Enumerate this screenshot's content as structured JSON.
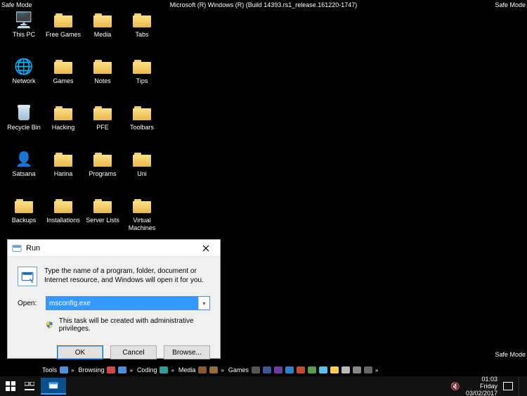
{
  "safemode": {
    "topLeft": "Safe Mode",
    "topRight": "Safe Mode",
    "bottomRight": "Safe Mode",
    "build": "Microsoft (R) Windows (R) (Build 14393.rs1_release.161220-1747)"
  },
  "desktop": [
    {
      "label": "This PC",
      "icon": "pc"
    },
    {
      "label": "Free Games",
      "icon": "folder"
    },
    {
      "label": "Media",
      "icon": "folder"
    },
    {
      "label": "Tabs",
      "icon": "folder"
    },
    null,
    {
      "label": "Network",
      "icon": "network"
    },
    {
      "label": "Games",
      "icon": "folder"
    },
    {
      "label": "Notes",
      "icon": "folder"
    },
    {
      "label": "Tips",
      "icon": "folder"
    },
    null,
    {
      "label": "Recycle Bin",
      "icon": "recycle"
    },
    {
      "label": "Hacking",
      "icon": "folder"
    },
    {
      "label": "PFE",
      "icon": "folder"
    },
    {
      "label": "Toolbars",
      "icon": "folder"
    },
    null,
    {
      "label": "Satsana",
      "icon": "app"
    },
    {
      "label": "Harina",
      "icon": "folder"
    },
    {
      "label": "Programs",
      "icon": "folder"
    },
    {
      "label": "Uni",
      "icon": "folder"
    },
    null,
    {
      "label": "Backups",
      "icon": "folder"
    },
    {
      "label": "Installations",
      "icon": "folder"
    },
    {
      "label": "Server Lists",
      "icon": "folder"
    },
    {
      "label": "Virtual Machines",
      "icon": "folder"
    },
    null,
    null,
    null,
    null,
    {
      "label": "",
      "hidden": true,
      "icon": "folder"
    },
    null
  ],
  "run": {
    "title": "Run",
    "desc": "Type the name of a program, folder, document or Internet resource, and Windows will open it for you.",
    "openLabel": "Open:",
    "value": "msconfig.exe",
    "admin": "This task will be created with administrative privileges.",
    "ok": "OK",
    "cancel": "Cancel",
    "browse": "Browse..."
  },
  "quicklaunch": {
    "groups": [
      {
        "name": "Tools",
        "icons": [
          {
            "c": "#4a90d9"
          }
        ]
      },
      {
        "name": "Browsing",
        "icons": [
          {
            "c": "#c94b4b"
          },
          {
            "c": "#4a90d9"
          }
        ]
      },
      {
        "name": "Coding",
        "icons": [
          {
            "c": "#2aa198"
          }
        ]
      },
      {
        "name": "Media",
        "icons": [
          {
            "c": "#8b5a2b"
          },
          {
            "c": "#946d3e"
          }
        ]
      },
      {
        "name": "Games",
        "icons": [
          {
            "c": "#555"
          },
          {
            "c": "#3b5998"
          },
          {
            "c": "#6b3fa0"
          },
          {
            "c": "#2a83c6"
          },
          {
            "c": "#c14b2f"
          },
          {
            "c": "#5b9b46"
          },
          {
            "c": "#58c0e8"
          },
          {
            "c": "#ffcc4d"
          },
          {
            "c": "#bbb"
          },
          {
            "c": "#888"
          },
          {
            "c": "#666"
          }
        ]
      }
    ]
  },
  "tray": {
    "time": "01:03",
    "day": "Friday",
    "date": "03/02/2017"
  }
}
